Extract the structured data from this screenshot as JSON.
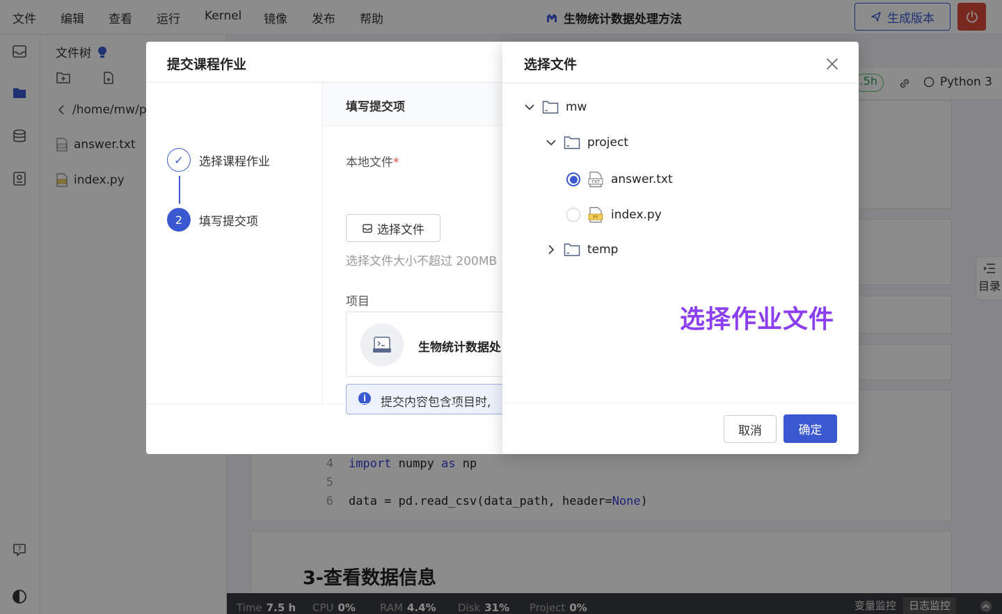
{
  "menu": [
    "文件",
    "编辑",
    "查看",
    "运行",
    "Kernel",
    "镜像",
    "发布",
    "帮助"
  ],
  "app_title": "生物统计数据处理方法",
  "header": {
    "generate_label": "生成版本"
  },
  "file_tree": {
    "title": "文件树",
    "path": "/home/mw/p",
    "files": [
      "answer.txt",
      "index.py"
    ]
  },
  "workspace": {
    "timer_pill": ".5h",
    "kernel": "Python 3",
    "toc_label": "目录",
    "code": [
      {
        "num": "4",
        "kw": "import",
        "rest": " numpy ",
        "kw2": "as",
        "rest2": " np"
      },
      {
        "num": "5",
        "kw": "",
        "rest": "",
        "kw2": "",
        "rest2": ""
      },
      {
        "num": "6",
        "kw": "",
        "rest": "data = pd.read_csv(data_path, header=",
        "kw2": "None",
        "rest2": ")"
      }
    ],
    "section_title": "3-查看数据信息"
  },
  "status": {
    "time_label": "Time",
    "time_value": "7.5 h",
    "cpu_label": "CPU",
    "cpu_value": "0%",
    "ram_label": "RAM",
    "ram_value": "4.4%",
    "disk_label": "Disk",
    "disk_value": "31%",
    "project_label": "Project",
    "project_value": "0%",
    "tab_var": "变量监控",
    "tab_log": "日志监控"
  },
  "submit_dialog": {
    "title": "提交课程作业",
    "steps": [
      {
        "num": "✓",
        "label": "选择课程作业"
      },
      {
        "num": "2",
        "label": "填写提交项"
      }
    ],
    "form_title": "填写提交项",
    "local_file_label": "本地文件",
    "required_mark": "*",
    "choose_file_btn": "选择文件",
    "size_hint": "选择文件大小不超过 200MB",
    "project_label": "项目",
    "project_name": "生物统计数据处",
    "info_text": "提交内容包含项目时,"
  },
  "file_dialog": {
    "title": "选择文件",
    "tree": {
      "root": "mw",
      "project": "project",
      "answer": "answer.txt",
      "index": "index.py",
      "temp": "temp"
    },
    "annotation": "选择作业文件",
    "cancel": "取消",
    "confirm": "确定"
  },
  "colors": {
    "accent": "#3a59d1",
    "danger": "#dd4a3a",
    "annotation": "#8b3ff0"
  }
}
